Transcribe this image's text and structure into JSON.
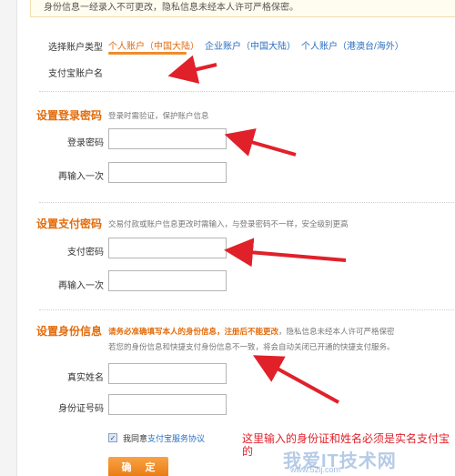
{
  "notice": "身份信息一经录入不可更改，隐私信息未经本人许可严格保密。",
  "account": {
    "type_label": "选择账户类型",
    "tabs": [
      "个人账户（中国大陆）",
      "企业账户（中国大陆）",
      "个人账户（港澳台/海外）"
    ],
    "active_tab": 0,
    "name_label": "支付宝账户名"
  },
  "login_password": {
    "title": "设置登录密码",
    "hint": "登录时需验证，保护账户信息",
    "field_label": "登录密码",
    "confirm_label": "再输入一次",
    "value": "",
    "confirm_value": ""
  },
  "pay_password": {
    "title": "设置支付密码",
    "hint": "交易付款或账户信息更改时需输入，与登录密码不一样，安全级别更高",
    "field_label": "支付密码",
    "confirm_label": "再输入一次",
    "value": "",
    "confirm_value": ""
  },
  "identity": {
    "title": "设置身份信息",
    "hint_strong": "请务必准确填写本人的身份信息，注册后不能更改",
    "hint_rest": "，隐私信息未经本人许可严格保密",
    "hint_line2": "若您的身份信息和快捷支付身份信息不一致，将会自动关闭已开通的快捷支付服务。",
    "name_label": "真实姓名",
    "id_label": "身份证号码",
    "name_value": "",
    "id_value": ""
  },
  "agreement": {
    "prefix": "我同意",
    "link": "支付宝服务协议",
    "checked": true
  },
  "confirm_button": "确 定",
  "annotation": {
    "note": "这里输入的身份证和姓名必须是实名支付宝的",
    "color": "#e0212a"
  },
  "watermark": {
    "text": "我爱IT技术网",
    "sub": "www.52ij.com"
  },
  "colors": {
    "accent": "#e36b0a",
    "link": "#2b6fc0",
    "arrow": "#e0212a"
  }
}
